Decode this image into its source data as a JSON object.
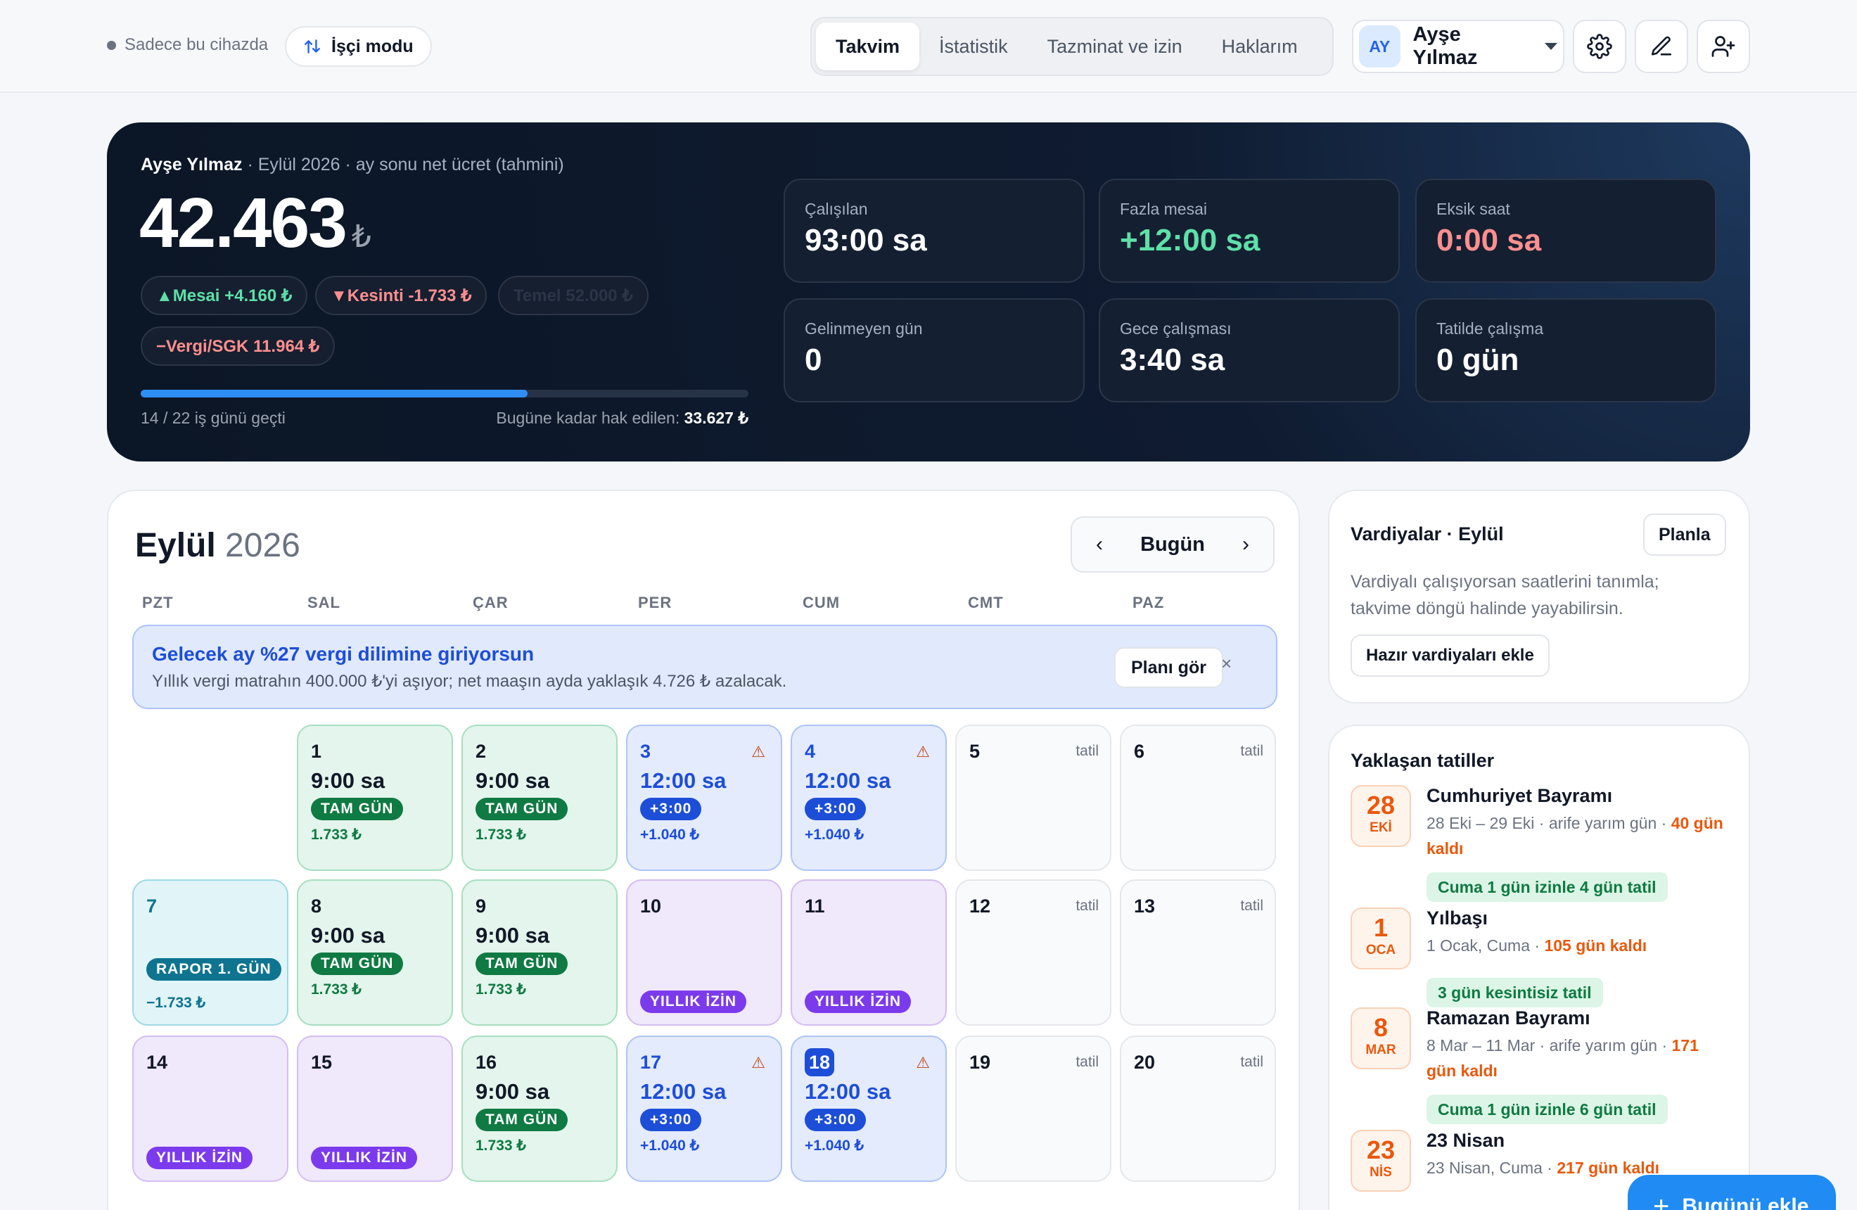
{
  "topbar": {
    "device_label": "Sadece bu cihazda",
    "mode_label": "İşçi modu",
    "tabs": [
      "Takvim",
      "İstatistik",
      "Tazminat ve izin",
      "Haklarım"
    ],
    "active_tab": "Takvim",
    "user": {
      "initials": "AY",
      "name": "Ayşe Yılmaz"
    }
  },
  "hero": {
    "name": "Ayşe Yılmaz",
    "subtitle": "· Eylül 2026 · ay sonu net ücret (tahmini)",
    "amount": "42.463",
    "currency": "₺",
    "pills": {
      "mesai": "▲Mesai +4.160 ₺",
      "kesinti": "▼Kesinti -1.733 ₺",
      "temel": "Temel 52.000 ₺",
      "vergi": "−Vergi/SGK 11.964 ₺"
    },
    "progress_fraction": 0.636,
    "progress_label": "14 / 22 iş günü geçti",
    "earned_label": "Bugüne kadar hak edilen:",
    "earned_value": "33.627 ₺",
    "stats": [
      {
        "label": "Çalışılan",
        "value": "93:00 sa",
        "color": "#ffffff"
      },
      {
        "label": "Fazla mesai",
        "value": "+12:00 sa",
        "color": "#5ee0a8"
      },
      {
        "label": "Eksik saat",
        "value": "0:00 sa",
        "color": "#ff8f8f"
      },
      {
        "label": "Gelinmeyen gün",
        "value": "0",
        "color": "#ffffff"
      },
      {
        "label": "Gece çalışması",
        "value": "3:40 sa",
        "color": "#ffffff"
      },
      {
        "label": "Tatilde çalışma",
        "value": "0 gün",
        "color": "#ffffff"
      }
    ]
  },
  "calendar": {
    "month": "Eylül",
    "year": "2026",
    "today_label": "Bugün",
    "weekdays": [
      "PZT",
      "SAL",
      "ÇAR",
      "PER",
      "CUM",
      "CMT",
      "PAZ"
    ],
    "alert": {
      "title": "Gelecek ay %27 vergi dilimine giriyorsun",
      "text": "Yıllık vergi matrahın 400.000 ₺'yi aşıyor; net maaşın ayda yaklaşık 4.726 ₺ azalacak.",
      "button": "Planı gör",
      "close": "×"
    },
    "tatil_label": "tatil",
    "days": [
      {
        "n": "1",
        "type": "work",
        "hours": "9:00 sa",
        "tag": "TAM GÜN",
        "money": "1.733 ₺"
      },
      {
        "n": "2",
        "type": "work",
        "hours": "9:00 sa",
        "tag": "TAM GÜN",
        "money": "1.733 ₺"
      },
      {
        "n": "3",
        "type": "ot",
        "hours": "12:00 sa",
        "tag": "+3:00",
        "money": "+1.040 ₺",
        "warn": true
      },
      {
        "n": "4",
        "type": "ot",
        "hours": "12:00 sa",
        "tag": "+3:00",
        "money": "+1.040 ₺",
        "warn": true
      },
      {
        "n": "5",
        "type": "off"
      },
      {
        "n": "6",
        "type": "off"
      },
      {
        "n": "7",
        "type": "sick",
        "tag": "RAPOR 1. GÜN",
        "money": "−1.733 ₺"
      },
      {
        "n": "8",
        "type": "work",
        "hours": "9:00 sa",
        "tag": "TAM GÜN",
        "money": "1.733 ₺"
      },
      {
        "n": "9",
        "type": "work",
        "hours": "9:00 sa",
        "tag": "TAM GÜN",
        "money": "1.733 ₺"
      },
      {
        "n": "10",
        "type": "leave",
        "tag": "YILLIK İZİN"
      },
      {
        "n": "11",
        "type": "leave",
        "tag": "YILLIK İZİN"
      },
      {
        "n": "12",
        "type": "off"
      },
      {
        "n": "13",
        "type": "off"
      },
      {
        "n": "14",
        "type": "leave",
        "tag": "YILLIK İZİN"
      },
      {
        "n": "15",
        "type": "leave",
        "tag": "YILLIK İZİN"
      },
      {
        "n": "16",
        "type": "work",
        "hours": "9:00 sa",
        "tag": "TAM GÜN",
        "money": "1.733 ₺"
      },
      {
        "n": "17",
        "type": "ot",
        "hours": "12:00 sa",
        "tag": "+3:00",
        "money": "+1.040 ₺",
        "warn": true
      },
      {
        "n": "18",
        "type": "ot",
        "hours": "12:00 sa",
        "tag": "+3:00",
        "money": "+1.040 ₺",
        "warn": true,
        "today": true
      },
      {
        "n": "19",
        "type": "off"
      },
      {
        "n": "20",
        "type": "off"
      }
    ]
  },
  "shifts": {
    "title": "Vardiyalar · Eylül",
    "plan_button": "Planla",
    "text": "Vardiyalı çalışıyorsan saatlerini tanımla; takvime döngü halinde yayabilirsin.",
    "add_button": "Hazır vardiyaları ekle"
  },
  "holidays": {
    "title": "Yaklaşan tatiller",
    "items": [
      {
        "day": "28",
        "mon": "EKİ",
        "name": "Cumhuriyet Bayramı",
        "meta": "28 Eki – 29 Eki · arife yarım gün · ",
        "left": "40 gün kaldı",
        "chip": "Cuma 1 gün izinle 4 gün tatil"
      },
      {
        "day": "1",
        "mon": "OCA",
        "name": "Yılbaşı",
        "meta": "1 Ocak, Cuma · ",
        "left": "105 gün kaldı",
        "chip": "3 gün kesintisiz tatil"
      },
      {
        "day": "8",
        "mon": "MAR",
        "name": "Ramazan Bayramı",
        "meta": "8 Mar – 11 Mar · arife yarım gün · ",
        "left": "171 gün kaldı",
        "chip": "Cuma 1 gün izinle 6 gün tatil"
      },
      {
        "day": "23",
        "mon": "NİS",
        "name": "23 Nisan",
        "meta": "23 Nisan, Cuma · ",
        "left": "217 gün kaldı",
        "chip": "3 gün kesintisiz tatil"
      }
    ]
  },
  "fab": {
    "label": "Bugünü ekle"
  }
}
